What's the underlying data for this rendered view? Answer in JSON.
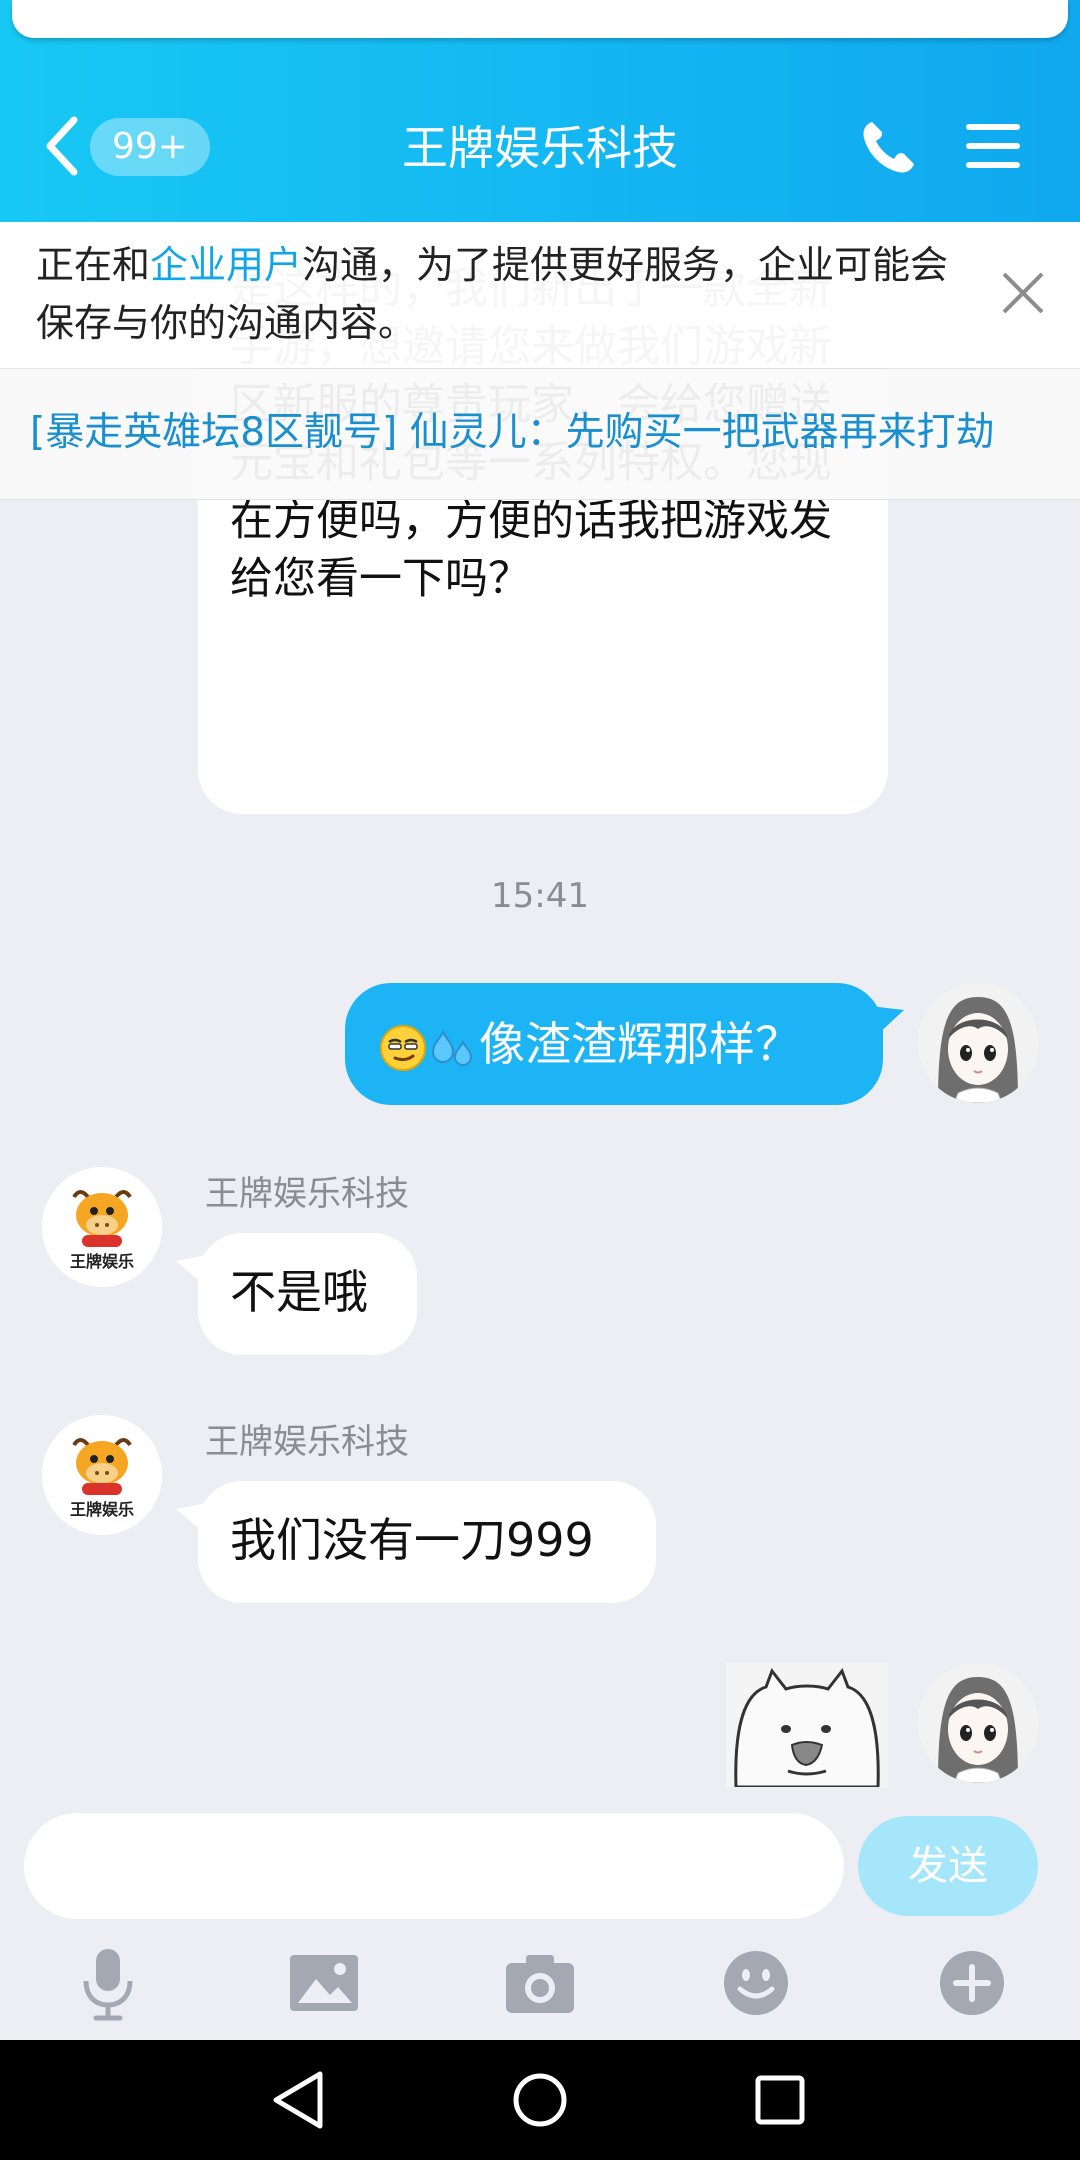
{
  "header": {
    "badge": "99+",
    "title": "王牌娱乐科技"
  },
  "notice": {
    "prefix": "正在和",
    "highlight": "企业用户",
    "suffix": "沟通，为了提供更好服务，企业可能会保存与你的沟通内容。"
  },
  "announcement": {
    "text": "[暴走英雄坛8区靓号] 仙灵儿：先购买一把武器再来打劫"
  },
  "messages": {
    "first_bubble_text": "是这样的，我们新出了一款全新手游，想邀请您来做我们游戏新区新服的尊贵玩家，会给您赠送元宝和礼包等一系列特权。您现在方便吗，方便的话我把游戏发给您看一下吗？",
    "timestamp": "15:41",
    "outgoing_text": "像渣渣辉那样？",
    "sender_name_1": "王牌娱乐科技",
    "incoming_1": "不是哦",
    "sender_name_2": "王牌娱乐科技",
    "incoming_2": "我们没有一刀999",
    "avatar_logo_text": "王牌娱乐"
  },
  "input": {
    "placeholder": "",
    "send_label": "发送"
  },
  "colors": {
    "header_start": "#18c8f4",
    "header_end": "#10a8ef",
    "accent": "#1cb4f5",
    "background": "#eceef4"
  }
}
